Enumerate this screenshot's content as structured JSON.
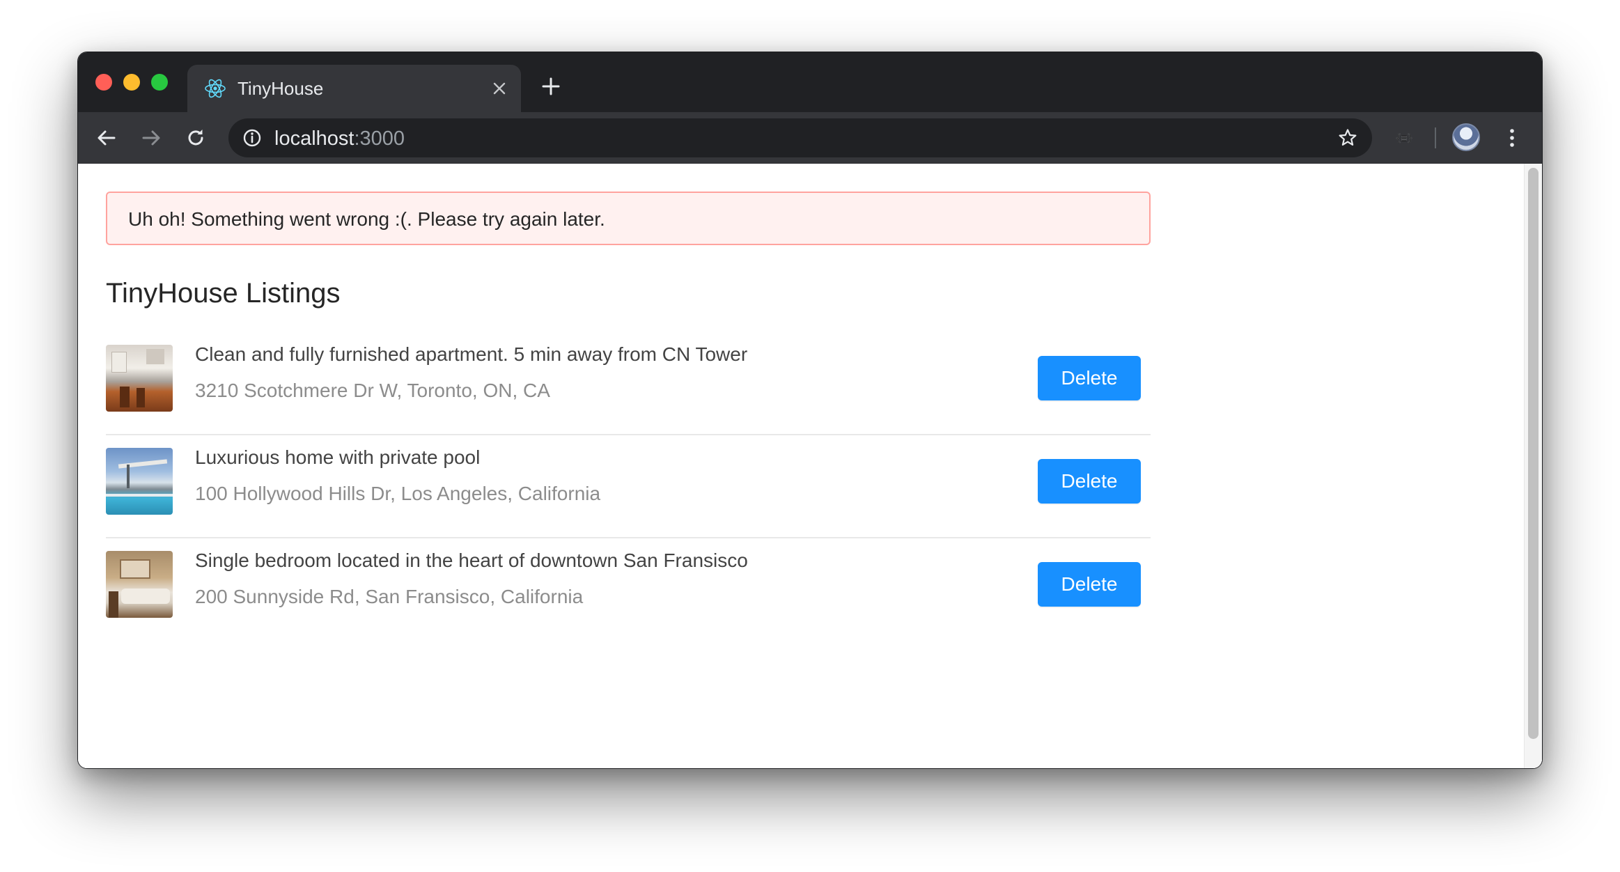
{
  "browser": {
    "tab": {
      "title": "TinyHouse"
    },
    "url": {
      "host": "localhost",
      "port": ":3000"
    }
  },
  "page": {
    "alert": "Uh oh! Something went wrong :(. Please try again later.",
    "title": "TinyHouse Listings",
    "delete_label": "Delete",
    "listings": [
      {
        "title": "Clean and fully furnished apartment. 5 min away from CN Tower",
        "address": "3210 Scotchmere Dr W, Toronto, ON, CA"
      },
      {
        "title": "Luxurious home with private pool",
        "address": "100 Hollywood Hills Dr, Los Angeles, California"
      },
      {
        "title": "Single bedroom located in the heart of downtown San Fransisco",
        "address": "200 Sunnyside Rd, San Fransisco, California"
      }
    ]
  },
  "colors": {
    "primary_button": "#1890ff",
    "alert_background": "#fff1f0",
    "alert_border": "#ffa39e",
    "browser_chrome": "#202124"
  },
  "icons": [
    "react-logo-icon",
    "close-icon",
    "plus-icon",
    "back-arrow-icon",
    "forward-arrow-icon",
    "reload-icon",
    "info-icon",
    "star-icon",
    "extension-icon",
    "avatar",
    "more-vert-icon"
  ]
}
